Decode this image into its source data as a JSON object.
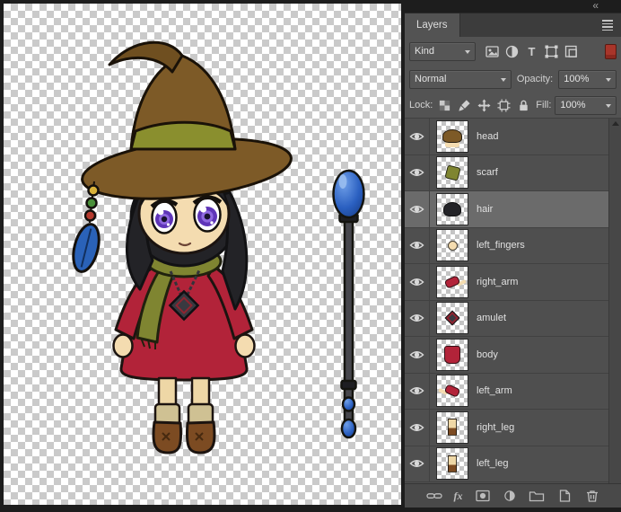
{
  "window": {
    "collapse_glyph": "«"
  },
  "panel": {
    "tab_label": "Layers",
    "filter_row": {
      "kind_label": "Kind"
    },
    "blend_row": {
      "mode": "Normal",
      "opacity_label": "Opacity:",
      "opacity_value": "100%"
    },
    "lock_row": {
      "lock_label": "Lock:",
      "fill_label": "Fill:",
      "fill_value": "100%"
    },
    "layers": [
      {
        "name": "head"
      },
      {
        "name": "scarf"
      },
      {
        "name": "hair",
        "selected": true
      },
      {
        "name": "left_fingers"
      },
      {
        "name": "right_arm"
      },
      {
        "name": "amulet"
      },
      {
        "name": "body"
      },
      {
        "name": "left_arm"
      },
      {
        "name": "right_leg"
      },
      {
        "name": "left_leg"
      }
    ],
    "bottom_bar": {
      "fx_label": "fx"
    }
  },
  "palette": {
    "panel_bg": "#535353",
    "panel_dark": "#3c3c3c",
    "selected_row": "#6b6b6b",
    "window_chrome": "#1d1d1d",
    "filter_toggle_red": "#a8352a",
    "hat_brown": "#7d5a27",
    "hat_band_olive": "#8a8f2e",
    "dress_red": "#b22339",
    "scarf_olive": "#7f8531",
    "skin": "#f4dcb0",
    "eye_purple": "#5f35b8",
    "hair_black": "#232327",
    "boots_brown": "#7c4b22",
    "staff_orb_blue": "#2a5fc0"
  }
}
